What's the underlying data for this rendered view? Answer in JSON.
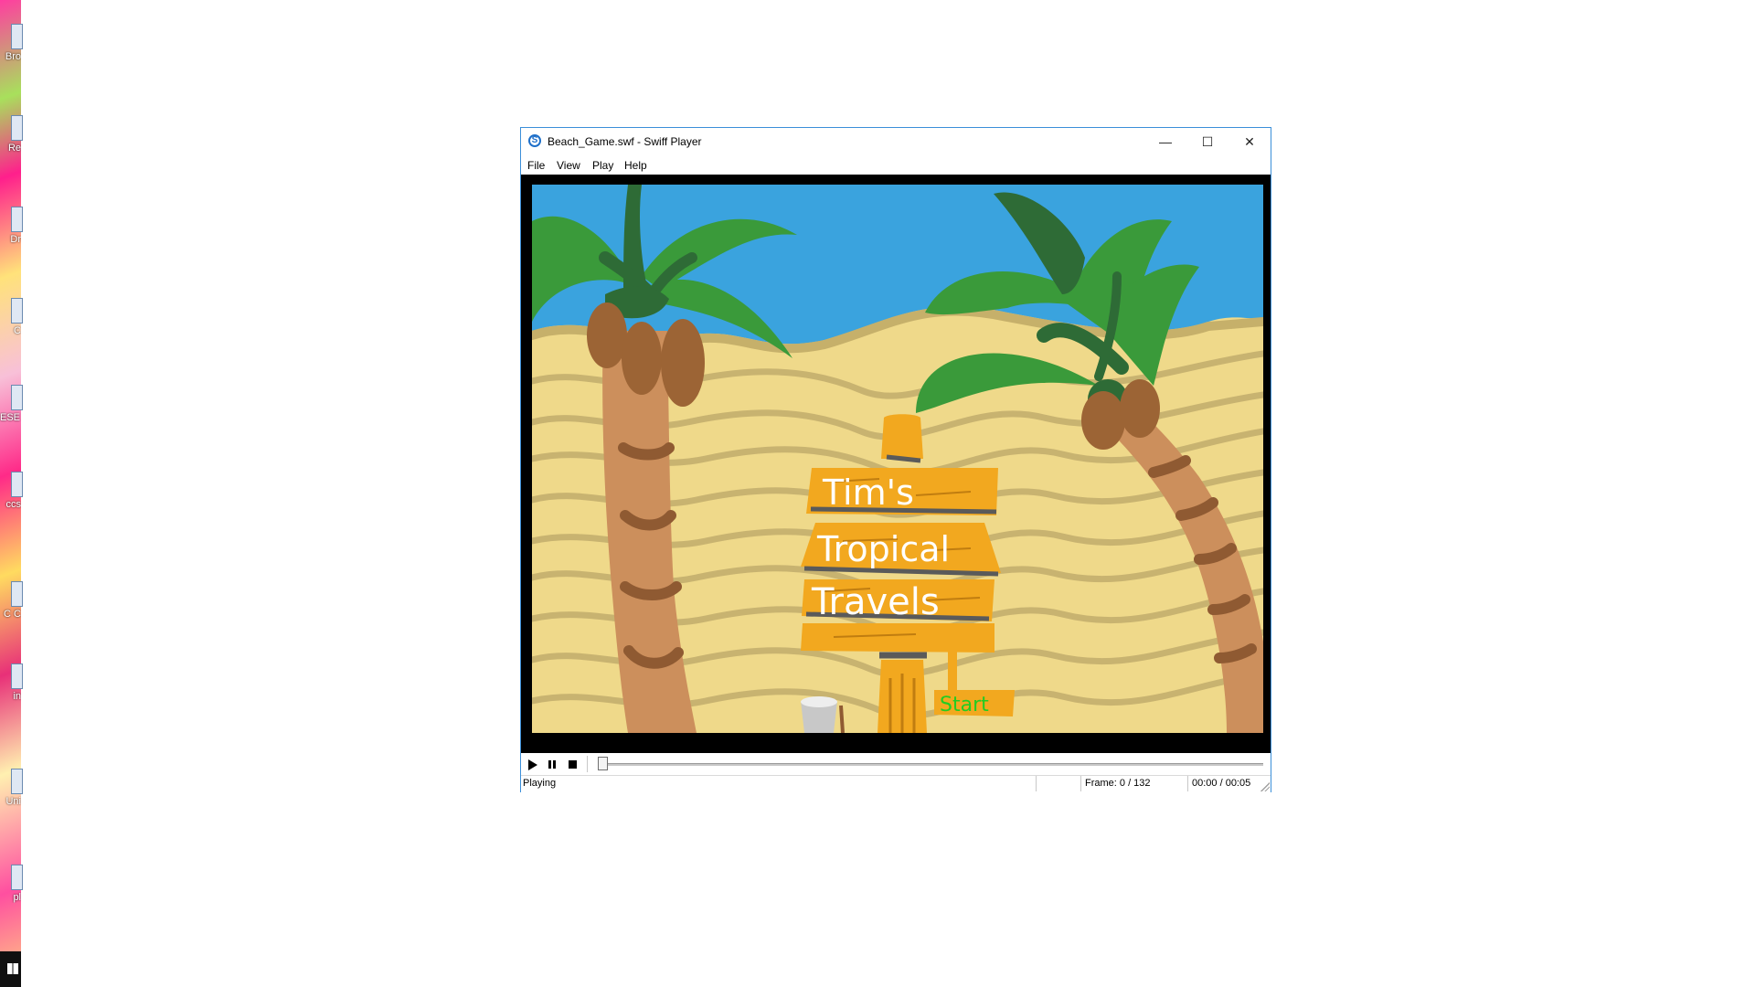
{
  "window": {
    "title": "Beach_Game.swf - Swiff Player",
    "app_icon_glyph": "S",
    "minimize_glyph": "—",
    "maximize_glyph": "☐",
    "close_glyph": "✕"
  },
  "menu": {
    "items": [
      {
        "label": "File"
      },
      {
        "label": "View"
      },
      {
        "label": "Play"
      },
      {
        "label": "Help"
      }
    ]
  },
  "stage": {
    "sign_line1": "Tim's",
    "sign_line2": "Tropical",
    "sign_line3": "Travels",
    "start_label": "Start",
    "sky_color": "#3aa3de",
    "sand_color": "#efd98a",
    "sign_color": "#f2a81f",
    "start_color": "#22cc22"
  },
  "controls": {
    "play_icon": "play-icon",
    "pause_icon": "pause-icon",
    "stop_icon": "stop-icon",
    "progress": 0
  },
  "status": {
    "state": "Playing",
    "frame": "Frame: 0 / 132",
    "time": "00:00 / 00:05"
  },
  "desktop": {
    "icon_labels": [
      "Bro",
      "Re",
      "Dr",
      "C",
      "ESE & P",
      "ccs",
      "C C",
      "in",
      "Uni",
      "pl"
    ]
  }
}
